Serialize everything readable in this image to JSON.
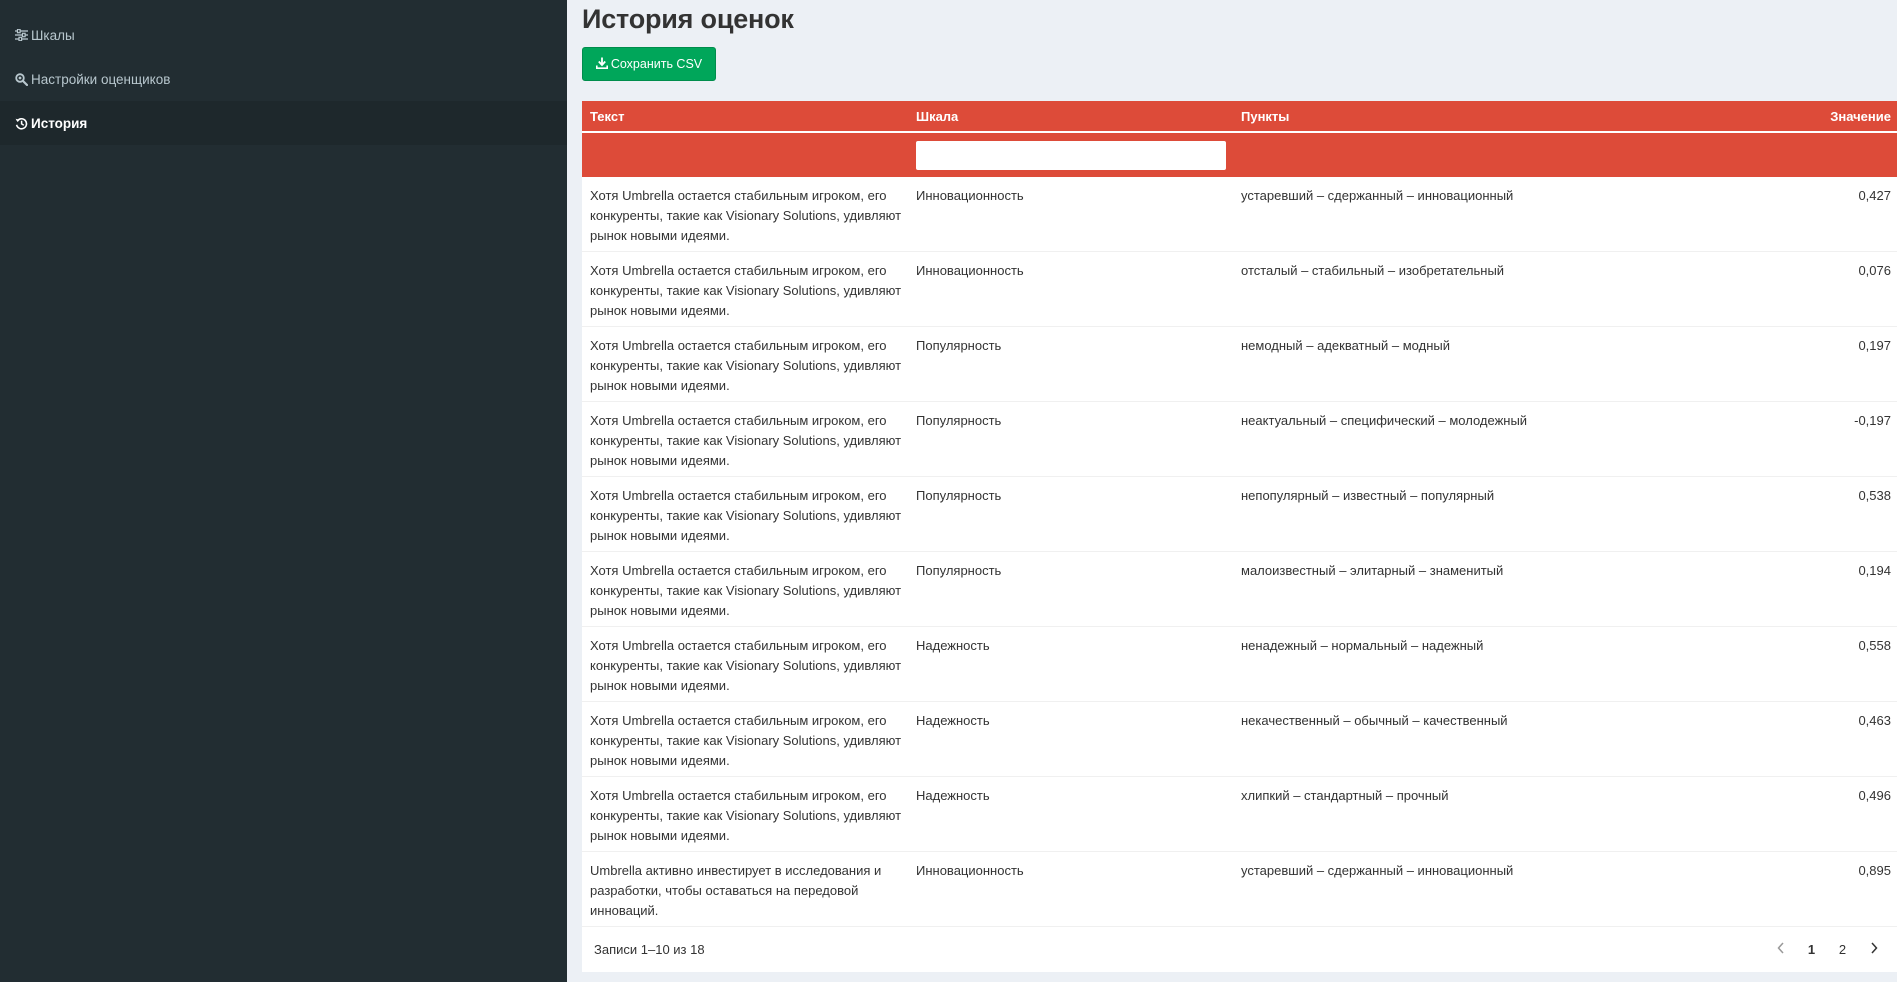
{
  "sidebar": {
    "items": [
      {
        "label": "Шкалы",
        "icon": "sliders-icon"
      },
      {
        "label": "Настройки оценщиков",
        "icon": "search-settings-icon"
      },
      {
        "label": "История",
        "icon": "history-icon"
      }
    ],
    "active_index": 2
  },
  "page": {
    "title": "История оценок",
    "csv_button_label": "Сохранить CSV"
  },
  "table": {
    "headers": {
      "text": "Текст",
      "scale": "Шкала",
      "items": "Пункты",
      "value": "Значение"
    },
    "filter": {
      "scale_value": ""
    },
    "rows": [
      {
        "text": "Хотя Umbrella остается стабильным игроком, его конкуренты, такие как Visionary Solutions, удивляют рынок новыми идеями.",
        "scale": "Инновационность",
        "items": "устаревший – сдержанный – инновационный",
        "value": "0,427"
      },
      {
        "text": "Хотя Umbrella остается стабильным игроком, его конкуренты, такие как Visionary Solutions, удивляют рынок новыми идеями.",
        "scale": "Инновационность",
        "items": "отсталый – стабильный – изобретательный",
        "value": "0,076"
      },
      {
        "text": "Хотя Umbrella остается стабильным игроком, его конкуренты, такие как Visionary Solutions, удивляют рынок новыми идеями.",
        "scale": "Популярность",
        "items": "немодный – адекватный – модный",
        "value": "0,197"
      },
      {
        "text": "Хотя Umbrella остается стабильным игроком, его конкуренты, такие как Visionary Solutions, удивляют рынок новыми идеями.",
        "scale": "Популярность",
        "items": "неактуальный – специфический – молодежный",
        "value": "-0,197"
      },
      {
        "text": "Хотя Umbrella остается стабильным игроком, его конкуренты, такие как Visionary Solutions, удивляют рынок новыми идеями.",
        "scale": "Популярность",
        "items": "непопулярный – известный – популярный",
        "value": "0,538"
      },
      {
        "text": "Хотя Umbrella остается стабильным игроком, его конкуренты, такие как Visionary Solutions, удивляют рынок новыми идеями.",
        "scale": "Популярность",
        "items": "малоизвестный – элитарный – знаменитый",
        "value": "0,194"
      },
      {
        "text": "Хотя Umbrella остается стабильным игроком, его конкуренты, такие как Visionary Solutions, удивляют рынок новыми идеями.",
        "scale": "Надежность",
        "items": "ненадежный – нормальный – надежный",
        "value": "0,558"
      },
      {
        "text": "Хотя Umbrella остается стабильным игроком, его конкуренты, такие как Visionary Solutions, удивляют рынок новыми идеями.",
        "scale": "Надежность",
        "items": "некачественный – обычный – качественный",
        "value": "0,463"
      },
      {
        "text": "Хотя Umbrella остается стабильным игроком, его конкуренты, такие как Visionary Solutions, удивляют рынок новыми идеями.",
        "scale": "Надежность",
        "items": "хлипкий – стандартный – прочный",
        "value": "0,496"
      },
      {
        "text": "Umbrella активно инвестирует в исследования и разработки, чтобы оставаться на передовой инноваций.",
        "scale": "Инновационность",
        "items": "устаревший – сдержанный – инновационный",
        "value": "0,895"
      }
    ]
  },
  "footer": {
    "records_text": "Записи 1–10 из 18",
    "pages": [
      "1",
      "2"
    ],
    "current_page": "1"
  },
  "colors": {
    "sidebar_bg": "#222d32",
    "active_item_bg": "#1e282c",
    "table_header": "#dd4b39",
    "button_green": "#00a65a",
    "page_bg": "#ecf0f5"
  }
}
